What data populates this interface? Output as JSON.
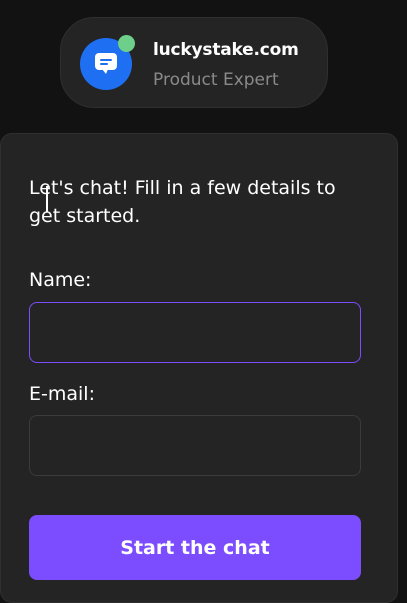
{
  "header": {
    "agent_name": "luckystake.com",
    "agent_role": "Product Expert",
    "avatar_icon": "chat-bubble-icon",
    "status_color": "#6ecf8a",
    "avatar_color": "#1e6ff2"
  },
  "form": {
    "intro_text": "Let's chat! Fill in a few details to get started.",
    "name_label": "Name:",
    "name_value": "",
    "email_label": "E-mail:",
    "email_value": "",
    "submit_label": "Start the chat",
    "accent_color": "#7c4dff"
  }
}
